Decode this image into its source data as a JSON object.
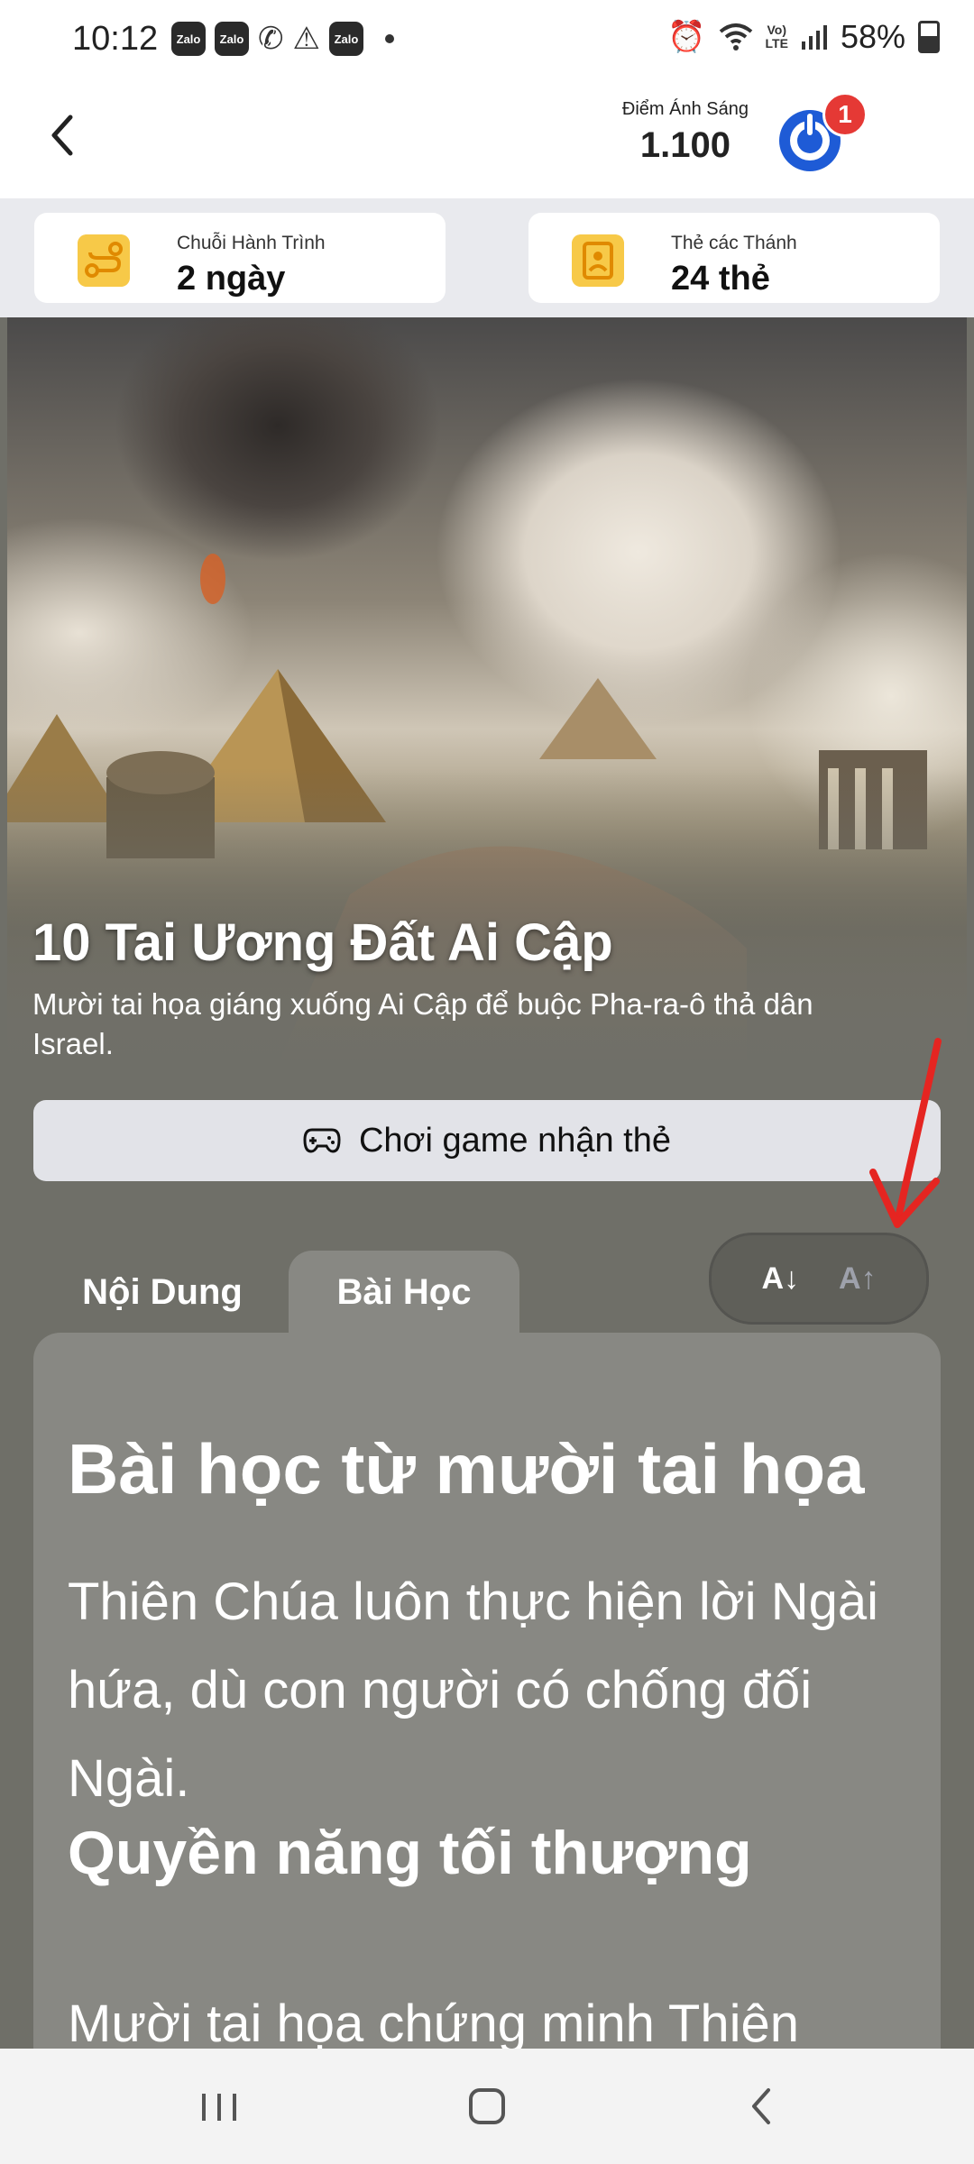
{
  "status_bar": {
    "time": "10:12",
    "left_icons": [
      "Zalo",
      "Zalo",
      "Zalo"
    ],
    "battery": "58%",
    "icons": [
      "viber-icon",
      "warning-icon",
      "alarm-icon",
      "wifi-icon",
      "volte-icon",
      "signal-icon",
      "battery-icon"
    ]
  },
  "header": {
    "points_label": "Điểm Ánh Sáng",
    "points_value": "1.100",
    "notification_count": "1"
  },
  "stats": {
    "streak_label": "Chuỗi Hành Trình",
    "streak_value": "2 ngày",
    "cards_label": "Thẻ các Thánh",
    "cards_value": "24 thẻ"
  },
  "hero": {
    "title": "10 Tai Ương Đất Ai Cập",
    "description": "Mười tai họa giáng xuống Ai Cập để buộc Pha-ra-ô thả dân Israel."
  },
  "game_button": {
    "label": "Chơi game nhận thẻ"
  },
  "tabs": [
    {
      "label": "Nội Dung",
      "active": false
    },
    {
      "label": "Bài Học",
      "active": true
    }
  ],
  "font_size_toggle": {
    "decrease": "A↓",
    "increase": "A↑"
  },
  "lesson": {
    "heading1": "Bài học từ mười tai họa",
    "paragraph1": "Thiên Chúa luôn thực hiện lời Ngài hứa, dù con người có chống đối Ngài.",
    "heading2": "Quyền năng tối thượng",
    "paragraph2": "Mười tai họa chứng minh Thiên"
  },
  "colors": {
    "background": "#6f6f68",
    "card": "#888883",
    "brand_blue": "#1e5bd6",
    "badge_red": "#e53935",
    "stat_icon": "#f7c948",
    "annotation_arrow": "#e52521"
  }
}
